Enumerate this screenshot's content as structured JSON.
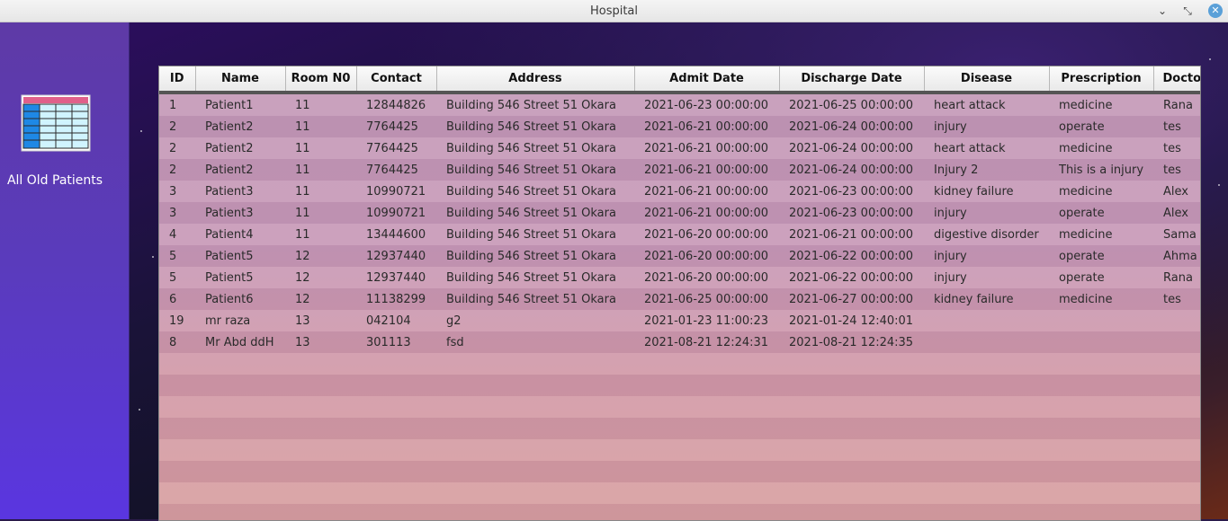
{
  "window": {
    "title": "Hospital"
  },
  "window_controls": {
    "minimize": "⌄",
    "maximize": "⤡",
    "close": "✕"
  },
  "sidebar": {
    "items": [
      {
        "label": "All Old Patients",
        "icon": "table-icon"
      }
    ]
  },
  "colors": {
    "sidebar": "#5a3bbd",
    "icon_header": "#e0608a",
    "icon_cells": "#d0f4ff",
    "icon_first_col": "#1e88e5"
  },
  "table": {
    "columns": [
      "ID",
      "Name",
      "Room N0",
      "Contact",
      "Address",
      "Admit Date",
      "Discharge Date",
      "Disease",
      "Prescription",
      "Doctor"
    ],
    "rows": [
      [
        "1",
        "Patient1",
        "11",
        "12844826",
        "Building 546 Street 51 Okara",
        "2021-06-23 00:00:00",
        "2021-06-25 00:00:00",
        "heart attack",
        "medicine",
        "Rana"
      ],
      [
        "2",
        "Patient2",
        "11",
        "7764425",
        "Building 546 Street 51 Okara",
        "2021-06-21 00:00:00",
        "2021-06-24 00:00:00",
        "injury",
        "operate",
        "tes"
      ],
      [
        "2",
        "Patient2",
        "11",
        "7764425",
        "Building 546 Street 51 Okara",
        "2021-06-21 00:00:00",
        "2021-06-24 00:00:00",
        "heart attack",
        "medicine",
        "tes"
      ],
      [
        "2",
        "Patient2",
        "11",
        "7764425",
        "Building 546 Street 51 Okara",
        "2021-06-21 00:00:00",
        "2021-06-24 00:00:00",
        "Injury 2",
        "This is a injury",
        "tes"
      ],
      [
        "3",
        "Patient3",
        "11",
        "10990721",
        "Building 546 Street 51 Okara",
        "2021-06-21 00:00:00",
        "2021-06-23 00:00:00",
        "kidney failure",
        "medicine",
        "Alex"
      ],
      [
        "3",
        "Patient3",
        "11",
        "10990721",
        "Building 546 Street 51 Okara",
        "2021-06-21 00:00:00",
        "2021-06-23 00:00:00",
        "injury",
        "operate",
        "Alex"
      ],
      [
        "4",
        "Patient4",
        "11",
        "13444600",
        "Building 546 Street 51 Okara",
        "2021-06-20 00:00:00",
        "2021-06-21 00:00:00",
        "digestive disorder",
        "medicine",
        "Sama"
      ],
      [
        "5",
        "Patient5",
        "12",
        "12937440",
        "Building 546 Street 51 Okara",
        "2021-06-20 00:00:00",
        "2021-06-22 00:00:00",
        "injury",
        "operate",
        "Ahma"
      ],
      [
        "5",
        "Patient5",
        "12",
        "12937440",
        "Building 546 Street 51 Okara",
        "2021-06-20 00:00:00",
        "2021-06-22 00:00:00",
        "injury",
        "operate",
        "Rana"
      ],
      [
        "6",
        "Patient6",
        "12",
        "11138299",
        "Building 546 Street 51 Okara",
        "2021-06-25 00:00:00",
        "2021-06-27 00:00:00",
        "kidney failure",
        "medicine",
        "tes"
      ],
      [
        "19",
        "mr raza",
        "13",
        "042104",
        "g2",
        "2021-01-23 11:00:23",
        "2021-01-24 12:40:01",
        "",
        "",
        ""
      ],
      [
        "8",
        "Mr Abd ddH",
        "13",
        "301113",
        "fsd",
        "2021-08-21 12:24:31",
        "2021-08-21 12:24:35",
        "",
        "",
        ""
      ]
    ]
  }
}
